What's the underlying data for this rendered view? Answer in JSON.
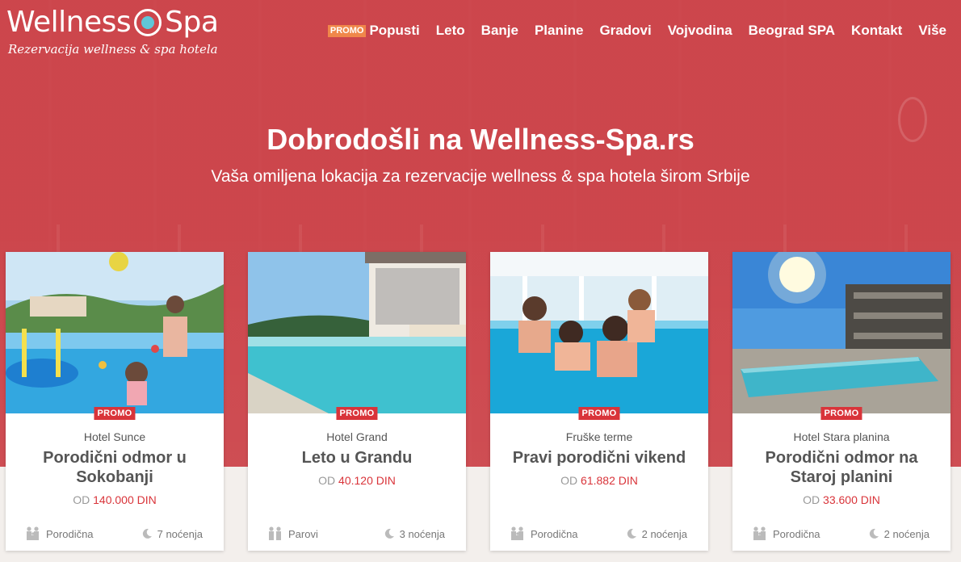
{
  "brand": {
    "name_left": "Wellness",
    "name_right": "Spa",
    "tagline": "Rezervacija wellness & spa hotela"
  },
  "nav": {
    "promo_tag": "PROMO",
    "items": [
      "Popusti",
      "Leto",
      "Banje",
      "Planine",
      "Gradovi",
      "Vojvodina",
      "Beograd SPA",
      "Kontakt",
      "Više"
    ]
  },
  "hero": {
    "title": "Dobrodošli na Wellness-Spa.rs",
    "subtitle": "Vaša omiljena lokacija za rezervacije wellness & spa hotela širom Srbije"
  },
  "cards": [
    {
      "badge": "PROMO",
      "hotel": "Hotel Sunce",
      "title": "Porodični odmor u Sokobanji",
      "price_prefix": "OD",
      "price": "140.000 DIN",
      "category": "Porodična",
      "nights": "7 noćenja",
      "category_icon": "family-icon"
    },
    {
      "badge": "PROMO",
      "hotel": "Hotel Grand",
      "title": "Leto u Grandu",
      "price_prefix": "OD",
      "price": "40.120 DIN",
      "category": "Parovi",
      "nights": "3 noćenja",
      "category_icon": "couple-icon"
    },
    {
      "badge": "PROMO",
      "hotel": "Fruške terme",
      "title": "Pravi porodični vikend",
      "price_prefix": "OD",
      "price": "61.882 DIN",
      "category": "Porodična",
      "nights": "2 noćenja",
      "category_icon": "family-icon"
    },
    {
      "badge": "PROMO",
      "hotel": "Hotel Stara planina",
      "title": "Porodični odmor na Staroj planini",
      "price_prefix": "OD",
      "price": "33.600 DIN",
      "category": "Porodična",
      "nights": "2 noćenja",
      "category_icon": "family-icon"
    }
  ],
  "colors": {
    "hero_red": "#cd464c",
    "promo_red": "#d9343a",
    "promo_orange": "#f0874a",
    "logo_drop": "#5fc6d8"
  }
}
